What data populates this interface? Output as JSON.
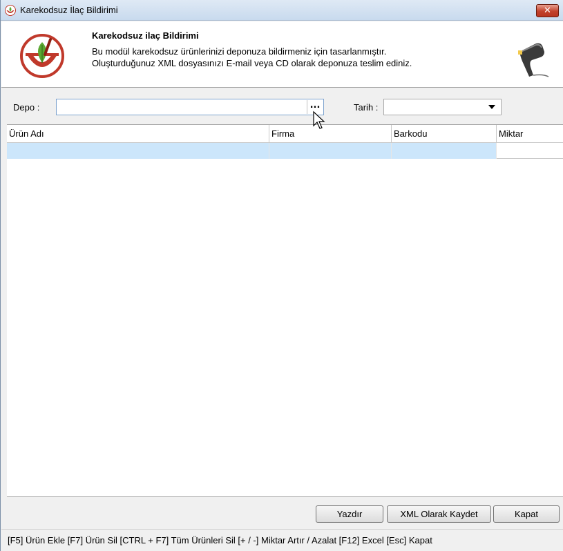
{
  "window": {
    "title": "Karekodsuz İlaç Bildirimi",
    "close_glyph": "✕"
  },
  "header": {
    "title": "Karekodsuz ilaç Bildirimi",
    "line1": "Bu modül karekodsuz ürünlerinizi deponuza bildirmeniz için tasarlanmıştır.",
    "line2": "Oluşturduğunuz XML dosyasınızı E-mail veya CD olarak deponuza teslim ediniz.",
    "logo_icon": "mortar-pestle-leaf-icon",
    "scanner_icon": "barcode-scanner-icon"
  },
  "form": {
    "depo_label": "Depo :",
    "depo_value": "",
    "depo_browse": "...",
    "tarih_label": "Tarih :",
    "tarih_value": ""
  },
  "grid": {
    "columns": [
      "Ürün Adı",
      "Firma",
      "Barkodu",
      "Miktar"
    ],
    "rows": [
      [
        "",
        "",
        "",
        ""
      ]
    ]
  },
  "buttons": {
    "print": "Yazdır",
    "save_xml": "XML Olarak Kaydet",
    "close": "Kapat"
  },
  "status": {
    "shortcuts": "[F5] Ürün Ekle   [F7] Ürün Sil   [CTRL + F7] Tüm Ürünleri Sil   [+ / -] Miktar Artır / Azalat   [F12] Excel   [Esc] Kapat"
  },
  "colors": {
    "selection": "#cce6fb",
    "close_button": "#c2422c",
    "logo_red": "#c0392b",
    "logo_green": "#5aa832"
  }
}
